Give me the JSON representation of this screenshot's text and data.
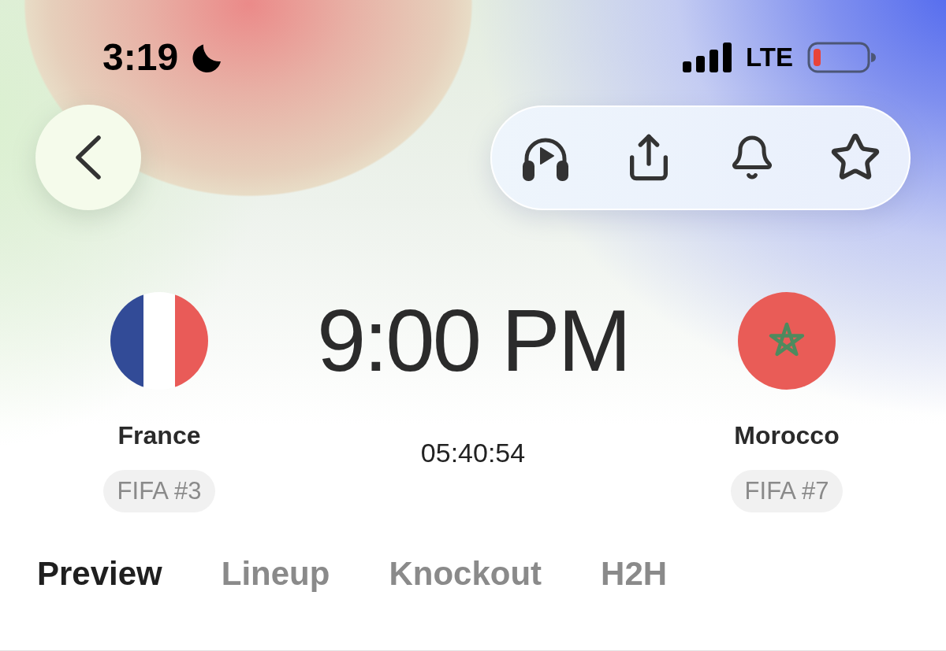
{
  "status_bar": {
    "time": "3:19",
    "network": "LTE"
  },
  "match": {
    "home": {
      "name": "France",
      "rank": "FIFA #3"
    },
    "kickoff": "9:00 PM",
    "countdown": "05:40:54",
    "away": {
      "name": "Morocco",
      "rank": "FIFA #7"
    }
  },
  "tabs": [
    {
      "label": "Preview",
      "selected": true
    },
    {
      "label": "Lineup",
      "selected": false
    },
    {
      "label": "Knockout",
      "selected": false
    },
    {
      "label": "H2H",
      "selected": false
    }
  ]
}
